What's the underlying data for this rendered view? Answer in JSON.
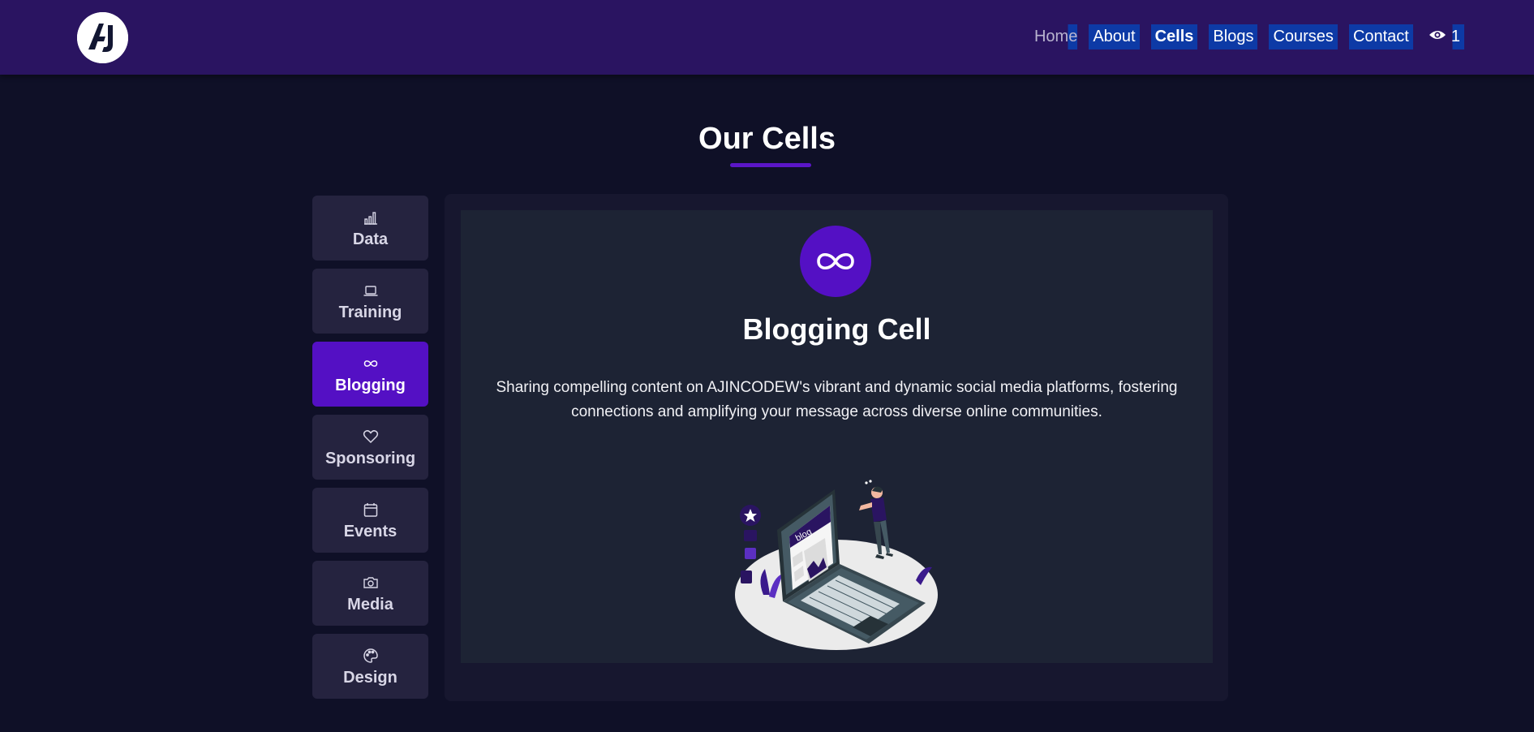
{
  "header": {
    "logo_icon": "aj-logo-icon",
    "nav": [
      {
        "label": "Home",
        "active": false
      },
      {
        "label": "About",
        "active": false
      },
      {
        "label": "Cells",
        "active": true
      },
      {
        "label": "Blogs",
        "active": false
      },
      {
        "label": "Courses",
        "active": false
      },
      {
        "label": "Contact",
        "active": false
      }
    ],
    "views_icon": "eye-icon",
    "views_count": "1"
  },
  "page": {
    "title": "Our Cells"
  },
  "tabs": [
    {
      "label": "Data",
      "icon": "bar-chart-icon",
      "active": false
    },
    {
      "label": "Training",
      "icon": "laptop-icon",
      "active": false
    },
    {
      "label": "Blogging",
      "icon": "infinity-icon",
      "active": true
    },
    {
      "label": "Sponsoring",
      "icon": "heart-icon",
      "active": false
    },
    {
      "label": "Events",
      "icon": "calendar-icon",
      "active": false
    },
    {
      "label": "Media",
      "icon": "camera-icon",
      "active": false
    },
    {
      "label": "Design",
      "icon": "palette-icon",
      "active": false
    }
  ],
  "cell": {
    "icon": "infinity-icon",
    "title": "Blogging Cell",
    "description": "Sharing compelling content on AJINCODEW's vibrant and dynamic social media platforms, fostering connections and amplifying your message across diverse online communities.",
    "illustration_text": "blog"
  },
  "colors": {
    "header_bg": "#2a1461",
    "page_bg": "#0f1027",
    "accent": "#5410c4",
    "nav_highlight": "#0d3aa6",
    "tab_bg": "#25233f",
    "panel_bg": "#17172f",
    "inner_bg": "#1d2334"
  }
}
